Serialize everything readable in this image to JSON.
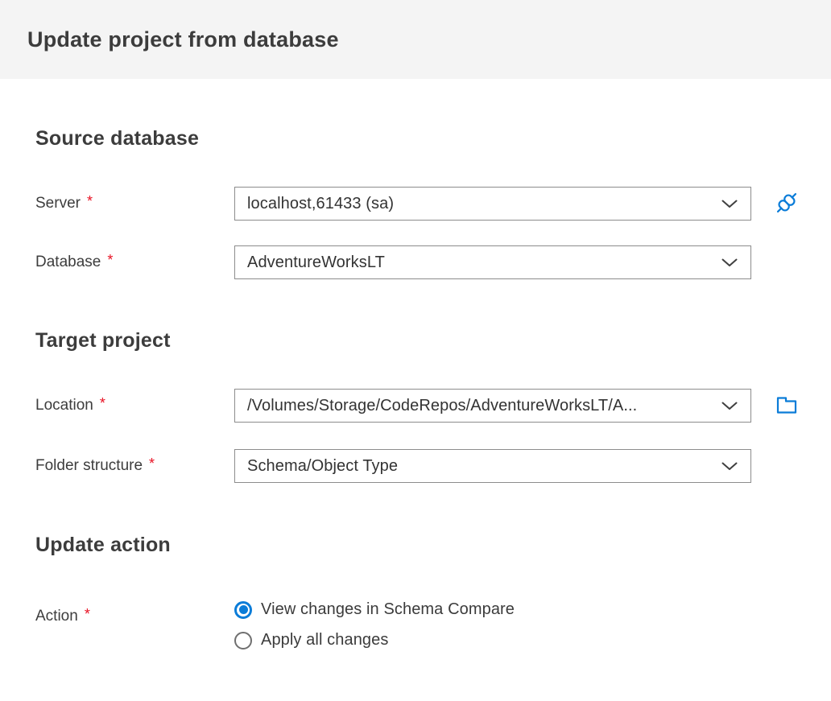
{
  "header": {
    "title": "Update project from database"
  },
  "required_marker": "*",
  "sections": {
    "source": {
      "heading": "Source database",
      "server": {
        "label": "Server",
        "value": "localhost,61433 (sa)"
      },
      "database": {
        "label": "Database",
        "value": "AdventureWorksLT"
      }
    },
    "target": {
      "heading": "Target project",
      "location": {
        "label": "Location",
        "value": "/Volumes/Storage/CodeRepos/AdventureWorksLT/A..."
      },
      "folder_structure": {
        "label": "Folder structure",
        "value": "Schema/Object Type"
      }
    },
    "update": {
      "heading": "Update action",
      "action_label": "Action",
      "options": [
        {
          "label": "View changes in Schema Compare",
          "selected": true
        },
        {
          "label": "Apply all changes",
          "selected": false
        }
      ]
    }
  },
  "icons": {
    "connect": "connect-plug-icon",
    "folder": "browse-folder-icon",
    "chevron": "chevron-down-icon"
  },
  "colors": {
    "accent_blue": "#0a7cd8",
    "required_red": "#e81123",
    "header_bg": "#f4f4f4",
    "field_border": "#8c8c8c"
  }
}
